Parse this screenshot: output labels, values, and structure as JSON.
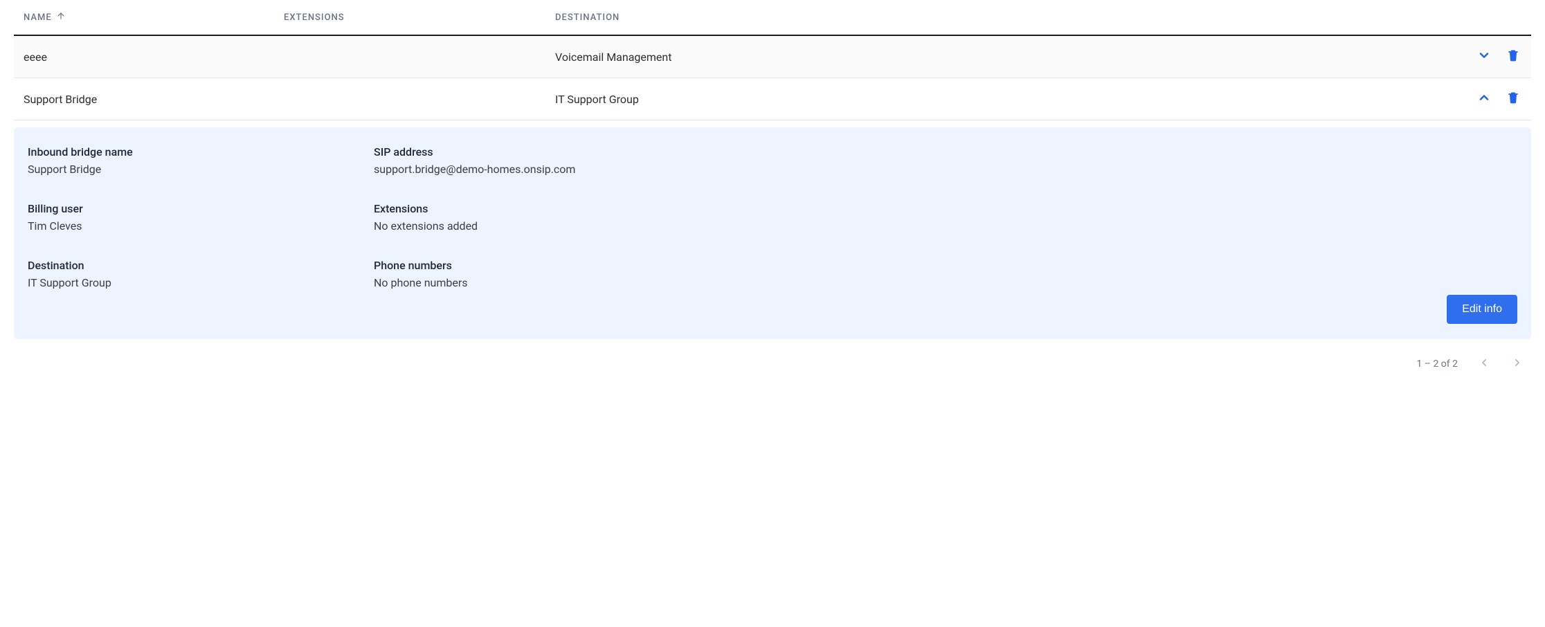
{
  "columns": {
    "name": "NAME",
    "extensions": "EXTENSIONS",
    "destination": "DESTINATION"
  },
  "rows": [
    {
      "name": "eeee",
      "extensions": "",
      "destination": "Voicemail Management",
      "expanded": false
    },
    {
      "name": "Support Bridge",
      "extensions": "",
      "destination": "IT Support Group",
      "expanded": true
    }
  ],
  "details": {
    "inbound_bridge_name": {
      "label": "Inbound bridge name",
      "value": "Support Bridge"
    },
    "sip_address": {
      "label": "SIP address",
      "value": "support.bridge@demo-homes.onsip.com"
    },
    "billing_user": {
      "label": "Billing user",
      "value": "Tim Cleves"
    },
    "extensions": {
      "label": "Extensions",
      "value": "No extensions added"
    },
    "destination": {
      "label": "Destination",
      "value": "IT Support Group"
    },
    "phone_numbers": {
      "label": "Phone numbers",
      "value": "No phone numbers"
    }
  },
  "buttons": {
    "edit_info": "Edit info"
  },
  "pagination": {
    "range_text": "1 – 2 of 2"
  },
  "colors": {
    "accent": "#2f6fed"
  }
}
